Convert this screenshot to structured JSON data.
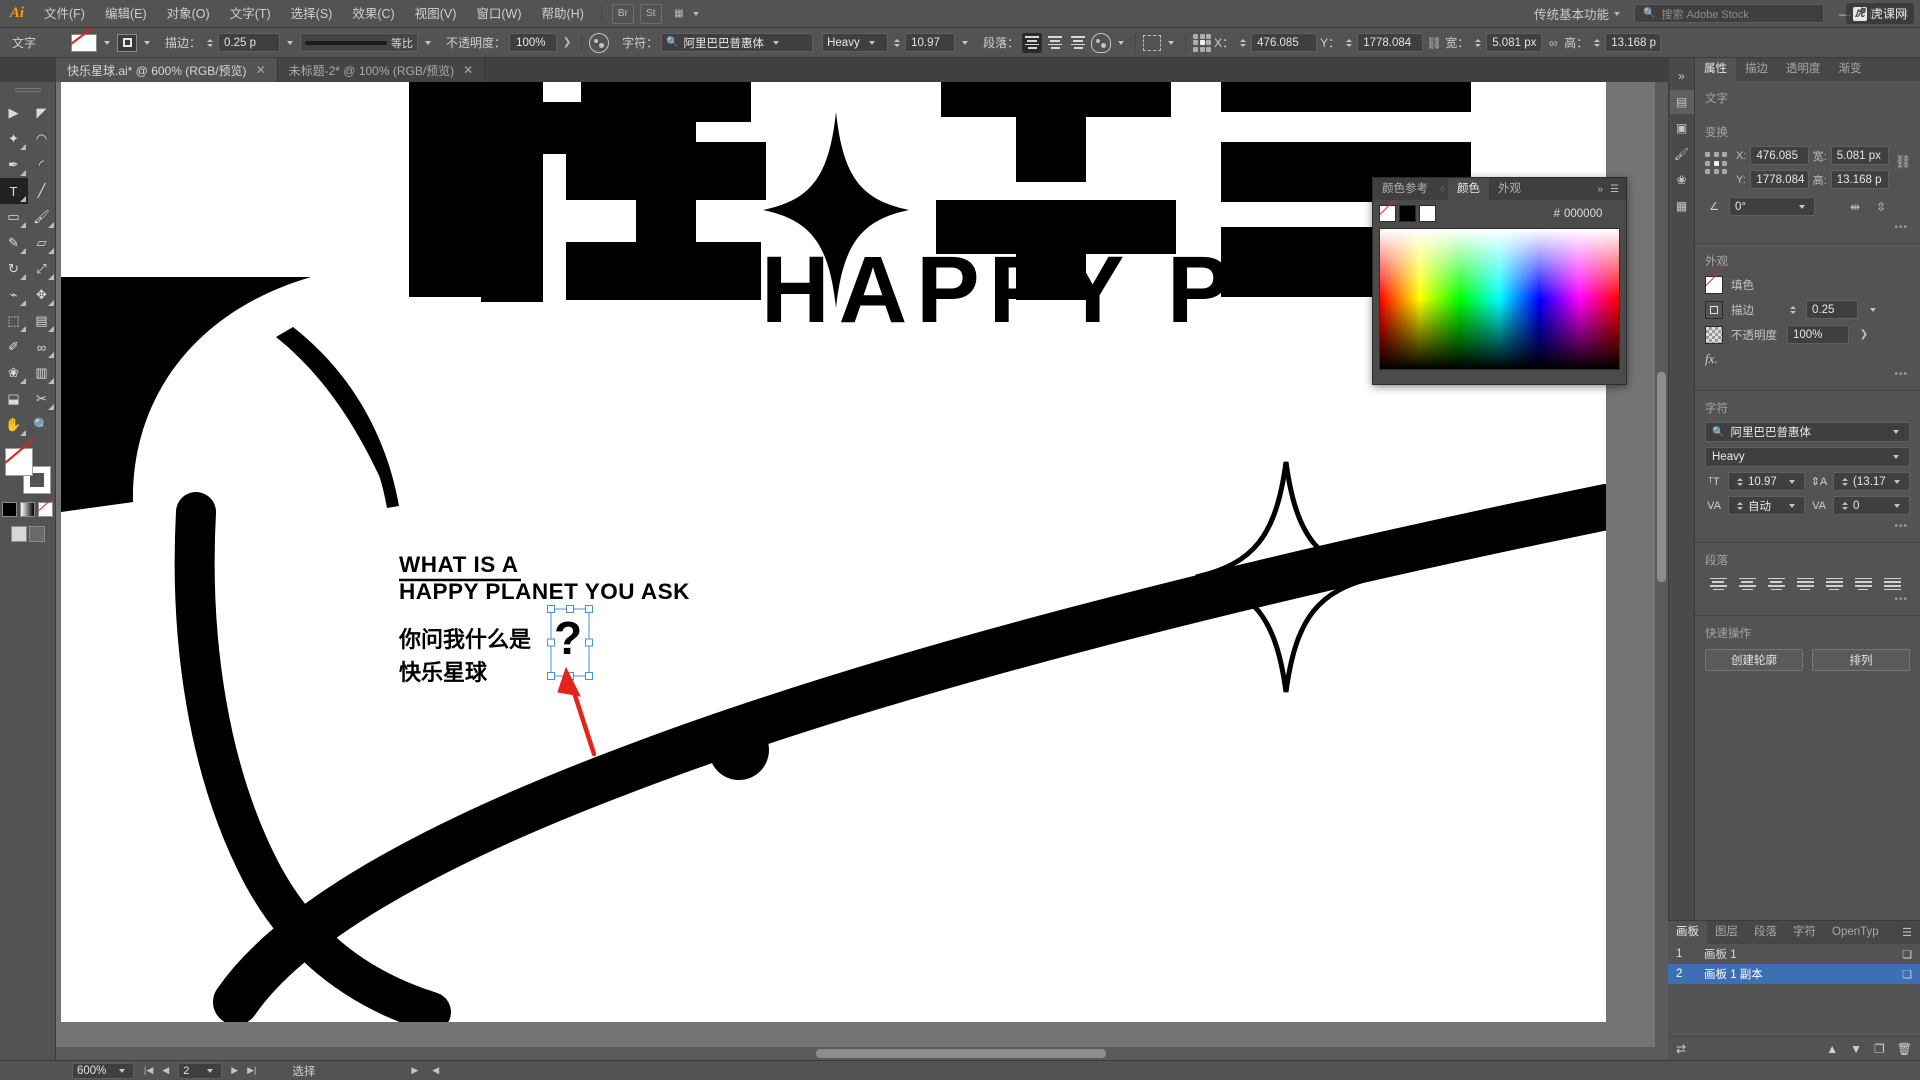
{
  "app": {
    "logo": "Ai",
    "menus": [
      "文件(F)",
      "编辑(E)",
      "对象(O)",
      "文字(T)",
      "选择(S)",
      "效果(C)",
      "视图(V)",
      "窗口(W)",
      "帮助(H)"
    ],
    "workspace": "传统基本功能",
    "stock_placeholder": "搜索 Adobe Stock",
    "window_buttons": [
      "—",
      "❐",
      "✕"
    ],
    "watermark": "虎课网"
  },
  "control_bar": {
    "tool_label": "文字",
    "stroke_label": "描边",
    "stroke_width": "0.25 p",
    "stroke_profile": "等比",
    "opacity_label": "不透明度",
    "opacity_value": "100%",
    "char_label": "字符",
    "font_family": "阿里巴巴普惠体",
    "font_style": "Heavy",
    "font_size": "10.97 ",
    "paragraph_label": "段落",
    "x_label": "X",
    "x_value": "476.085 ",
    "y_label": "Y",
    "y_value": "1778.084",
    "w_label": "宽",
    "w_value": "5.081 px",
    "h_label": "高",
    "h_value": "13.168 p"
  },
  "tabs": [
    {
      "title": "快乐星球.ai* @ 600% (RGB/预览)",
      "active": true
    },
    {
      "title": "未标题-2* @ 100% (RGB/预览)",
      "active": false
    }
  ],
  "toolbar": {
    "tools": [
      [
        "selection-tool",
        "▶"
      ],
      [
        "direct-selection-tool",
        "◤"
      ],
      [
        "magic-wand-tool",
        "✦"
      ],
      [
        "lasso-tool",
        "◡"
      ],
      [
        "pen-tool",
        "✒"
      ],
      [
        "curvature-tool",
        "◜"
      ],
      [
        "type-tool",
        "T"
      ],
      [
        "line-segment-tool",
        "╲"
      ],
      [
        "rectangle-tool",
        "▭"
      ],
      [
        "paintbrush-tool",
        "🖌"
      ],
      [
        "shaper-tool",
        "✎"
      ],
      [
        "eraser-tool",
        "◻"
      ],
      [
        "rotate-tool",
        "↻"
      ],
      [
        "scale-tool",
        "⤢"
      ],
      [
        "width-tool",
        "⌁"
      ],
      [
        "free-transform-tool",
        "✥"
      ],
      [
        "shape-builder-tool",
        "⬚"
      ],
      [
        "gradient-tool",
        "▤"
      ],
      [
        "eyedropper-tool",
        "✐"
      ],
      [
        "blend-tool",
        "∞"
      ],
      [
        "symbol-sprayer-tool",
        "❀"
      ],
      [
        "column-graph-tool",
        "▥"
      ],
      [
        "artboard-tool",
        "⬓"
      ],
      [
        "slice-tool",
        "✂"
      ],
      [
        "hand-tool",
        "✋"
      ],
      [
        "zoom-tool",
        "🔍"
      ]
    ]
  },
  "color_panel": {
    "tabs": [
      "颜色参考",
      "颜色",
      "外观"
    ],
    "active_tab": "颜色",
    "hex_symbol": "#",
    "hex_value": "000000"
  },
  "properties": {
    "tabs": [
      "属性",
      "描边",
      "透明度",
      "渐变"
    ],
    "active_tab": "属性",
    "section_text": "文字",
    "section_transform": "变换",
    "x_label": "X:",
    "x_value": "476.085",
    "y_label": "Y:",
    "y_value": "1778.084",
    "w_label": "宽:",
    "w_value": "5.081 px",
    "h_label": "高:",
    "h_value": "13.168 p",
    "angle_value": "0°",
    "section_appearance": "外观",
    "fill_label": "填色",
    "stroke_label": "描边",
    "stroke_value": "0.25",
    "opacity_label": "不透明度",
    "opacity_value": "100%",
    "fx_label": "fx.",
    "section_character": "字符",
    "font_family": "阿里巴巴普惠体",
    "font_style": "Heavy",
    "font_size": "10.97 ",
    "leading": "(13.17",
    "kerning": "自动",
    "tracking": "0",
    "section_paragraph": "段落",
    "section_quick_actions": "快速操作",
    "quick_action_1": "创建轮廓",
    "quick_action_2": "排列"
  },
  "artboards_panel": {
    "tabs": [
      "画板",
      "图层",
      "段落",
      "字符",
      "OpenTyp"
    ],
    "active_tab": "画板",
    "rows": [
      {
        "num": "1",
        "name": "画板 1",
        "selected": false
      },
      {
        "num": "2",
        "name": "画板 1 副本",
        "selected": true
      }
    ]
  },
  "status_bar": {
    "zoom": "600%",
    "page": "2",
    "tool_status": "选择"
  },
  "artwork": {
    "heading_cn_top": "快乐星",
    "heading_en": "HAPPY P",
    "text_en_line1": "WHAT IS A",
    "text_en_line2": "HAPPY PLANET YOU ASK",
    "text_cn_line1": "你问我什么是",
    "text_cn_line2": "快乐星球",
    "selected_glyph": "?"
  }
}
